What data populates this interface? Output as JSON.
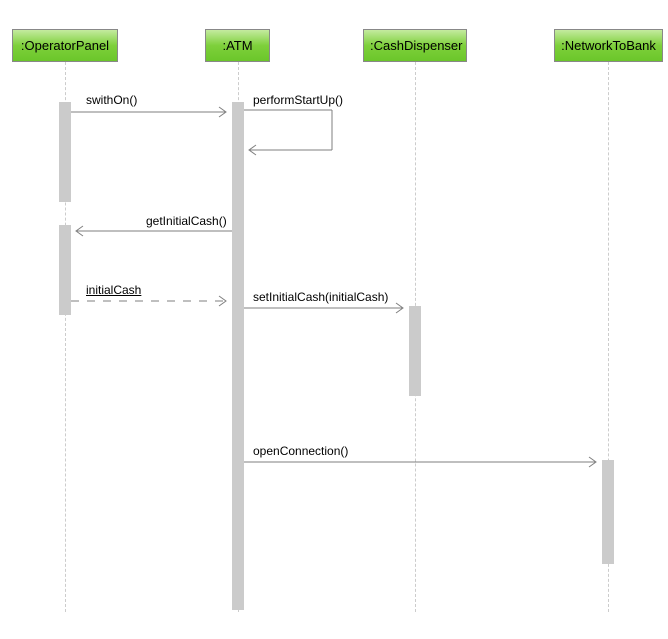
{
  "participants": {
    "operatorPanel": ":OperatorPanel",
    "atm": ":ATM",
    "cashDispenser": ":CashDispenser",
    "networkToBank": ":NetworkToBank"
  },
  "messages": {
    "switchOn": "swithOn()",
    "performStartUp": "performStartUp()",
    "getInitialCash": "getInitialCash()",
    "initialCash": "initialCash",
    "setInitialCash": "setInitialCash(initialCash)",
    "openConnection": "openConnection()"
  }
}
